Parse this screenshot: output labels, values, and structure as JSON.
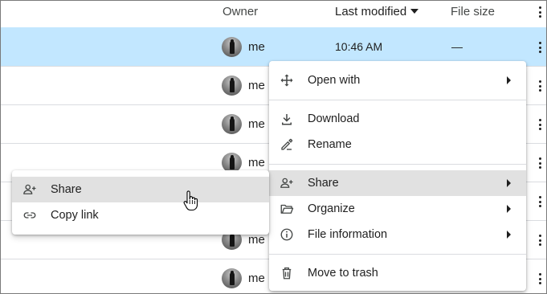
{
  "header": {
    "owner": "Owner",
    "last_modified": "Last modified",
    "file_size": "File size"
  },
  "rows": [
    {
      "owner": "me",
      "modified": "10:46 AM",
      "size": "—",
      "selected": true
    },
    {
      "owner": "me",
      "modified": "",
      "size": ""
    },
    {
      "owner": "me",
      "modified": "",
      "size": ""
    },
    {
      "owner": "me",
      "modified": "",
      "size": ""
    },
    {
      "owner": "",
      "modified": "",
      "size": ""
    },
    {
      "owner": "me",
      "modified": "",
      "size": ""
    },
    {
      "owner": "me",
      "modified": "",
      "size": ""
    }
  ],
  "context_menu": {
    "open_with": "Open with",
    "download": "Download",
    "rename": "Rename",
    "share": "Share",
    "organize": "Organize",
    "file_information": "File information",
    "move_to_trash": "Move to trash"
  },
  "share_submenu": {
    "share": "Share",
    "copy_link": "Copy link"
  },
  "colors": {
    "selected_row": "#c2e7ff",
    "menu_highlight": "#e1e1e1",
    "divider": "#dadce0",
    "text": "#1f1f1f"
  },
  "icons": {
    "header_sort": "arrow-drop-down-icon",
    "row_menu": "more-vert-icon",
    "open_with": "move-arrows-icon",
    "download": "download-icon",
    "rename": "edit-pencil-icon",
    "share": "person-add-icon",
    "organize": "folder-open-icon",
    "file_information": "info-icon",
    "move_to_trash": "trash-icon",
    "copy_link": "link-icon",
    "cursor": "hand-pointer-icon"
  }
}
